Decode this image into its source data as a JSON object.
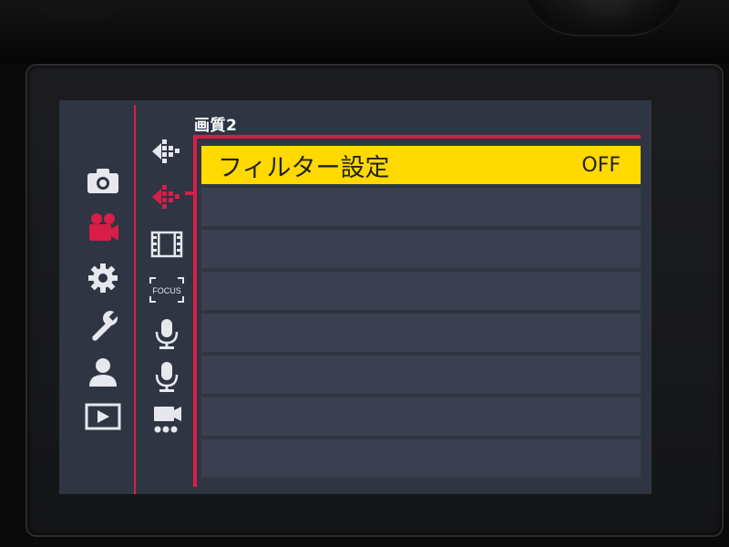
{
  "screen": {
    "page_title": "画質2",
    "menu_rows": [
      {
        "label": "フィルター設定",
        "value": "OFF",
        "selected": true
      },
      {
        "label": "",
        "value": "",
        "selected": false
      },
      {
        "label": "",
        "value": "",
        "selected": false
      },
      {
        "label": "",
        "value": "",
        "selected": false
      },
      {
        "label": "",
        "value": "",
        "selected": false
      },
      {
        "label": "",
        "value": "",
        "selected": false
      },
      {
        "label": "",
        "value": "",
        "selected": false
      },
      {
        "label": "",
        "value": "",
        "selected": false
      }
    ]
  },
  "categories": [
    {
      "icon": "camera-icon",
      "selected": false
    },
    {
      "icon": "movie-camera-icon",
      "selected": true
    },
    {
      "icon": "gear-icon",
      "selected": false
    },
    {
      "icon": "wrench-icon",
      "selected": false
    },
    {
      "icon": "person-icon",
      "selected": false
    },
    {
      "icon": "playback-icon",
      "selected": false
    }
  ],
  "subcategories": [
    {
      "icon": "image-quality-1-icon",
      "label": "",
      "selected": false
    },
    {
      "icon": "image-quality-2-icon",
      "label": "",
      "selected": true
    },
    {
      "icon": "film-strip-icon",
      "label": "",
      "selected": false
    },
    {
      "icon": "focus-icon",
      "label": "FOCUS",
      "selected": false
    },
    {
      "icon": "microphone-1-icon",
      "label": "",
      "selected": false
    },
    {
      "icon": "microphone-2-icon",
      "label": "",
      "selected": false
    },
    {
      "icon": "movie-other-icon",
      "label": "",
      "selected": false
    }
  ],
  "colors": {
    "accent": "#d81e47",
    "highlight": "#ffd900",
    "background": "#2f3543",
    "row": "#3a4050",
    "icon": "#e6e8ee"
  }
}
